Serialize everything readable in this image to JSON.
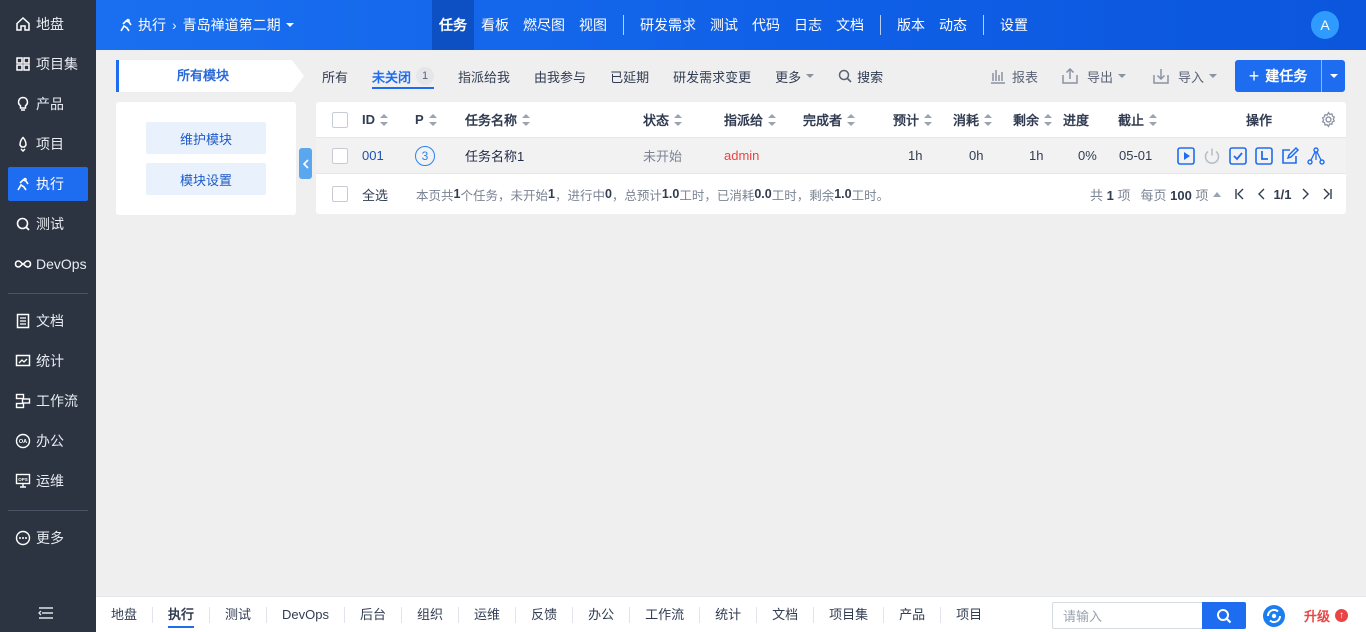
{
  "sidebar": {
    "items": [
      {
        "label": "地盘",
        "icon": "home-icon"
      },
      {
        "label": "项目集",
        "icon": "grid-icon"
      },
      {
        "label": "产品",
        "icon": "lightbulb-icon"
      },
      {
        "label": "项目",
        "icon": "project-icon"
      },
      {
        "label": "执行",
        "icon": "run-icon"
      },
      {
        "label": "测试",
        "icon": "test-icon"
      },
      {
        "label": "DevOps",
        "icon": "infinity-icon"
      },
      {
        "label": "文档",
        "icon": "document-icon"
      },
      {
        "label": "统计",
        "icon": "chart-icon"
      },
      {
        "label": "工作流",
        "icon": "workflow-icon"
      },
      {
        "label": "办公",
        "icon": "oa-icon"
      },
      {
        "label": "运维",
        "icon": "ops-icon"
      },
      {
        "label": "更多",
        "icon": "more-icon"
      }
    ],
    "active_index": 4
  },
  "topbar": {
    "crumb_root": "执行",
    "crumb_current": "青岛禅道第二期",
    "nav": [
      "任务",
      "看板",
      "燃尽图",
      "视图",
      "研发需求",
      "测试",
      "代码",
      "日志",
      "文档",
      "版本",
      "动态",
      "设置"
    ],
    "active": "任务",
    "avatar": "A"
  },
  "modules": {
    "header": "所有模块",
    "buttons": [
      "维护模块",
      "模块设置"
    ]
  },
  "subnav": {
    "tabs": [
      {
        "label": "所有"
      },
      {
        "label": "未关闭",
        "badge": "1"
      },
      {
        "label": "指派给我"
      },
      {
        "label": "由我参与"
      },
      {
        "label": "已延期"
      },
      {
        "label": "研发需求变更"
      },
      {
        "label": "更多"
      }
    ],
    "search": "搜索",
    "active_index": 1
  },
  "toolbar": {
    "report": "报表",
    "export": "导出",
    "import": "导入",
    "create": "建任务"
  },
  "table": {
    "headers": {
      "id": "ID",
      "pri": "P",
      "name": "任务名称",
      "status": "状态",
      "assigned": "指派给",
      "finished_by": "完成者",
      "estimate": "预计",
      "consumed": "消耗",
      "left": "剩余",
      "progress": "进度",
      "deadline": "截止",
      "actions": "操作"
    },
    "rows": [
      {
        "id": "001",
        "pri": "3",
        "name": "任务名称1",
        "status": "未开始",
        "assigned": "admin",
        "finished_by": "",
        "estimate": "1h",
        "consumed": "0h",
        "left": "1h",
        "progress": "0%",
        "deadline": "05-01"
      }
    ],
    "footer": {
      "select_all": "全选",
      "summary_parts": [
        "本页共 ",
        "1",
        " 个任务，未开始 ",
        "1",
        "，进行中 ",
        "0",
        "，总预计 ",
        "1.0",
        " 工时，已消耗 ",
        "0.0",
        " 工时，剩余 ",
        "1.0",
        " 工时。"
      ],
      "total_pre": "共 ",
      "total": "1",
      "total_post": " 项",
      "per_page_pre": "每页 ",
      "per_page": "100",
      "per_page_post": " 项",
      "page": "1/1"
    }
  },
  "bottom": {
    "nav": [
      "地盘",
      "执行",
      "测试",
      "DevOps",
      "后台",
      "组织",
      "运维",
      "反馈",
      "办公",
      "工作流",
      "统计",
      "文档",
      "项目集",
      "产品",
      "项目"
    ],
    "active": "执行",
    "search_placeholder": "请输入",
    "upgrade": "升级"
  },
  "colors": {
    "accent": "#1e6df0",
    "sidebar_bg": "#2c3441",
    "assigned_red": "#e84545",
    "status_gray": "#7b8494"
  }
}
